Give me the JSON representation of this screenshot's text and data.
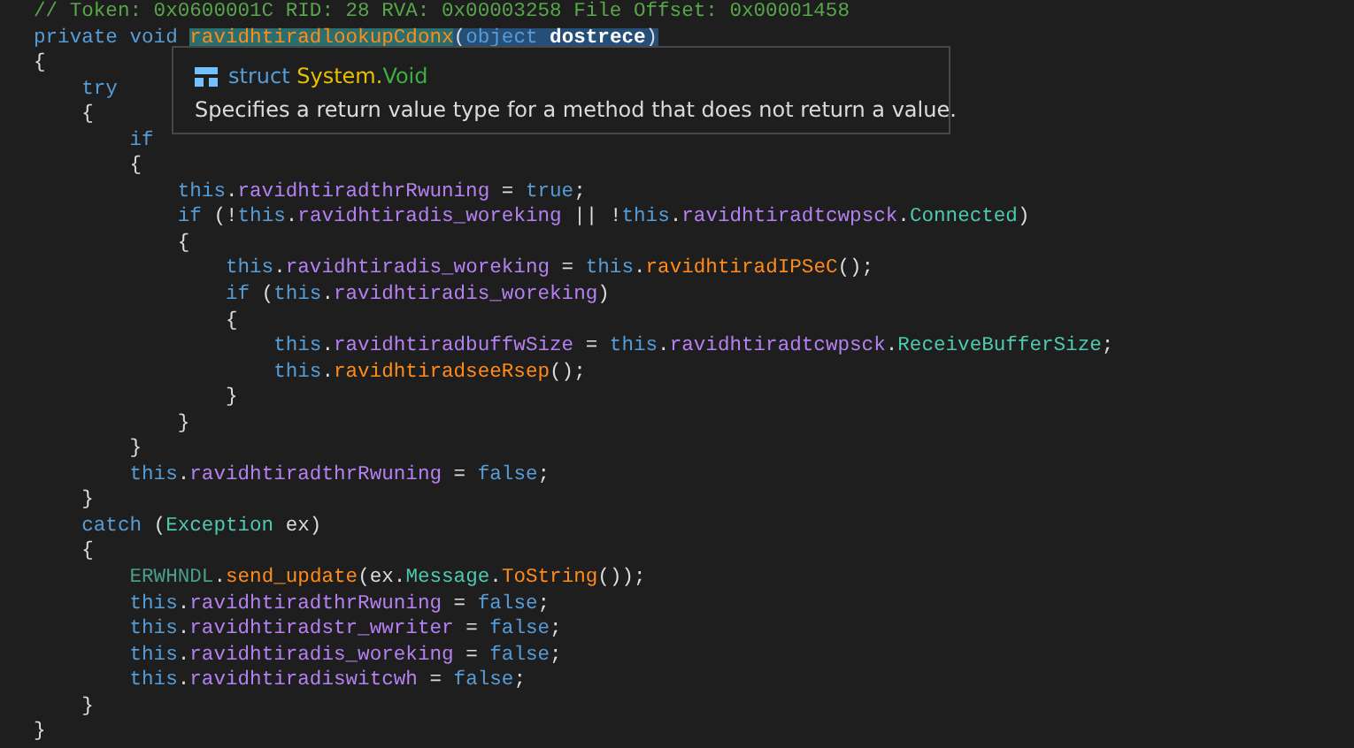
{
  "code_lines": [
    [
      {
        "text": "// Token: 0x0600001C RID: 28 RVA: 0x00003258 File Offset: 0x00001458",
        "kind": "comment"
      }
    ],
    [
      {
        "text": "private void ",
        "kind": "keyword"
      },
      {
        "text": "ravidhtiradlookupCdonx",
        "kind": "method",
        "highlighted": true
      },
      {
        "text": "(",
        "kind": "plain",
        "selected": true
      },
      {
        "text": "object",
        "kind": "keyword",
        "selected": true
      },
      {
        "text": " dostrece",
        "kind": "parameter",
        "selected": true
      },
      {
        "text": ")",
        "kind": "plain",
        "selected": true
      }
    ],
    [
      {
        "text": "{",
        "kind": "plain"
      }
    ],
    [
      {
        "text": "    try",
        "kind": "keyword"
      }
    ],
    [
      {
        "text": "    {",
        "kind": "plain"
      }
    ],
    [
      {
        "text": "        if",
        "kind": "keyword"
      }
    ],
    [
      {
        "text": "        {",
        "kind": "plain"
      }
    ],
    [
      {
        "text": "            this",
        "kind": "keyword"
      },
      {
        "text": ".",
        "kind": "plain"
      },
      {
        "text": "ravidhtiradthrRwuning",
        "kind": "field"
      },
      {
        "text": " = ",
        "kind": "plain"
      },
      {
        "text": "true",
        "kind": "keyword"
      },
      {
        "text": ";",
        "kind": "plain"
      }
    ],
    [
      {
        "text": "            if",
        "kind": "keyword"
      },
      {
        "text": " (!",
        "kind": "plain"
      },
      {
        "text": "this",
        "kind": "keyword"
      },
      {
        "text": ".",
        "kind": "plain"
      },
      {
        "text": "ravidhtiradis_woreking",
        "kind": "field"
      },
      {
        "text": " || !",
        "kind": "plain"
      },
      {
        "text": "this",
        "kind": "keyword"
      },
      {
        "text": ".",
        "kind": "plain"
      },
      {
        "text": "ravidhtiradtcwpsck",
        "kind": "field"
      },
      {
        "text": ".",
        "kind": "plain"
      },
      {
        "text": "Connected",
        "kind": "type"
      },
      {
        "text": ")",
        "kind": "plain"
      }
    ],
    [
      {
        "text": "            {",
        "kind": "plain"
      }
    ],
    [
      {
        "text": "                this",
        "kind": "keyword"
      },
      {
        "text": ".",
        "kind": "plain"
      },
      {
        "text": "ravidhtiradis_woreking",
        "kind": "field"
      },
      {
        "text": " = ",
        "kind": "plain"
      },
      {
        "text": "this",
        "kind": "keyword"
      },
      {
        "text": ".",
        "kind": "plain"
      },
      {
        "text": "ravidhtiradIPSeC",
        "kind": "method"
      },
      {
        "text": "();",
        "kind": "plain"
      }
    ],
    [
      {
        "text": "                if",
        "kind": "keyword"
      },
      {
        "text": " (",
        "kind": "plain"
      },
      {
        "text": "this",
        "kind": "keyword"
      },
      {
        "text": ".",
        "kind": "plain"
      },
      {
        "text": "ravidhtiradis_woreking",
        "kind": "field"
      },
      {
        "text": ")",
        "kind": "plain"
      }
    ],
    [
      {
        "text": "                {",
        "kind": "plain"
      }
    ],
    [
      {
        "text": "                    this",
        "kind": "keyword"
      },
      {
        "text": ".",
        "kind": "plain"
      },
      {
        "text": "ravidhtiradbuffwSize",
        "kind": "field"
      },
      {
        "text": " = ",
        "kind": "plain"
      },
      {
        "text": "this",
        "kind": "keyword"
      },
      {
        "text": ".",
        "kind": "plain"
      },
      {
        "text": "ravidhtiradtcwpsck",
        "kind": "field"
      },
      {
        "text": ".",
        "kind": "plain"
      },
      {
        "text": "ReceiveBufferSize",
        "kind": "type"
      },
      {
        "text": ";",
        "kind": "plain"
      }
    ],
    [
      {
        "text": "                    this",
        "kind": "keyword"
      },
      {
        "text": ".",
        "kind": "plain"
      },
      {
        "text": "ravidhtiradseeRsep",
        "kind": "method"
      },
      {
        "text": "();",
        "kind": "plain"
      }
    ],
    [
      {
        "text": "                }",
        "kind": "plain"
      }
    ],
    [
      {
        "text": "            }",
        "kind": "plain"
      }
    ],
    [
      {
        "text": "        }",
        "kind": "plain"
      }
    ],
    [
      {
        "text": "        this",
        "kind": "keyword"
      },
      {
        "text": ".",
        "kind": "plain"
      },
      {
        "text": "ravidhtiradthrRwuning",
        "kind": "field"
      },
      {
        "text": " = ",
        "kind": "plain"
      },
      {
        "text": "false",
        "kind": "keyword"
      },
      {
        "text": ";",
        "kind": "plain"
      }
    ],
    [
      {
        "text": "    }",
        "kind": "plain"
      }
    ],
    [
      {
        "text": "    catch",
        "kind": "keyword"
      },
      {
        "text": " (",
        "kind": "plain"
      },
      {
        "text": "Exception",
        "kind": "type"
      },
      {
        "text": " ex)",
        "kind": "plain"
      }
    ],
    [
      {
        "text": "    {",
        "kind": "plain"
      }
    ],
    [
      {
        "text": "        ERWHNDL",
        "kind": "class"
      },
      {
        "text": ".",
        "kind": "plain"
      },
      {
        "text": "send_update",
        "kind": "method"
      },
      {
        "text": "(ex.",
        "kind": "plain"
      },
      {
        "text": "Message",
        "kind": "type"
      },
      {
        "text": ".",
        "kind": "plain"
      },
      {
        "text": "ToString",
        "kind": "method"
      },
      {
        "text": "());",
        "kind": "plain"
      }
    ],
    [
      {
        "text": "        this",
        "kind": "keyword"
      },
      {
        "text": ".",
        "kind": "plain"
      },
      {
        "text": "ravidhtiradthrRwuning",
        "kind": "field"
      },
      {
        "text": " = ",
        "kind": "plain"
      },
      {
        "text": "false",
        "kind": "keyword"
      },
      {
        "text": ";",
        "kind": "plain"
      }
    ],
    [
      {
        "text": "        this",
        "kind": "keyword"
      },
      {
        "text": ".",
        "kind": "plain"
      },
      {
        "text": "ravidhtiradstr_wwriter",
        "kind": "field"
      },
      {
        "text": " = ",
        "kind": "plain"
      },
      {
        "text": "false",
        "kind": "keyword"
      },
      {
        "text": ";",
        "kind": "plain"
      }
    ],
    [
      {
        "text": "        this",
        "kind": "keyword"
      },
      {
        "text": ".",
        "kind": "plain"
      },
      {
        "text": "ravidhtiradis_woreking",
        "kind": "field"
      },
      {
        "text": " = ",
        "kind": "plain"
      },
      {
        "text": "false",
        "kind": "keyword"
      },
      {
        "text": ";",
        "kind": "plain"
      }
    ],
    [
      {
        "text": "        this",
        "kind": "keyword"
      },
      {
        "text": ".",
        "kind": "plain"
      },
      {
        "text": "ravidhtiradiswitcwh",
        "kind": "field"
      },
      {
        "text": " = ",
        "kind": "plain"
      },
      {
        "text": "false",
        "kind": "keyword"
      },
      {
        "text": ";",
        "kind": "plain"
      }
    ],
    [
      {
        "text": "    }",
        "kind": "plain"
      }
    ],
    [
      {
        "text": "}",
        "kind": "plain"
      }
    ]
  ],
  "tooltip": {
    "signature": [
      {
        "text": "struct ",
        "kind": "keyword"
      },
      {
        "text": "System.",
        "kind": "namespace"
      },
      {
        "text": "Void",
        "kind": "typename"
      }
    ],
    "description": "Specifies a return value type for a method that does not return a value."
  }
}
